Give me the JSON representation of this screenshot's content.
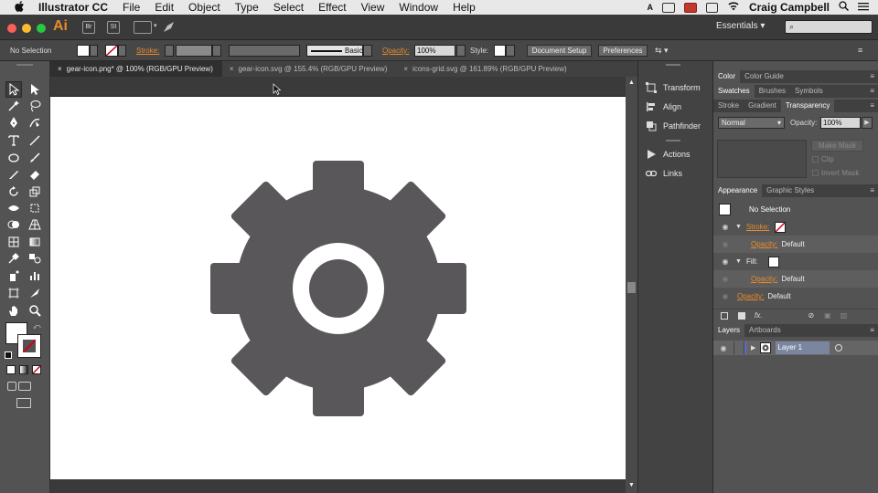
{
  "menubar": {
    "app_name": "Illustrator CC",
    "items": [
      "File",
      "Edit",
      "Object",
      "Type",
      "Select",
      "Effect",
      "View",
      "Window",
      "Help"
    ],
    "user": "Craig Campbell"
  },
  "appbar": {
    "logo": "Ai",
    "bridge_label": "Br",
    "stock_label": "St",
    "workspace": "Essentials",
    "search_placeholder": "⌕"
  },
  "control_bar": {
    "selection": "No Selection",
    "stroke_label": "Stroke:",
    "brush_label": "Basic",
    "opacity_label": "Opacity:",
    "opacity_value": "100%",
    "style_label": "Style:",
    "doc_setup": "Document Setup",
    "preferences": "Preferences"
  },
  "tabs": [
    {
      "label": "gear-icon.png* @ 100% (RGB/GPU Preview)",
      "active": true
    },
    {
      "label": "gear-icon.svg @ 155.4% (RGB/GPU Preview)",
      "active": false
    },
    {
      "label": "icons-grid.svg @ 161.89% (RGB/GPU Preview)",
      "active": false
    }
  ],
  "dock": {
    "items": [
      "Transform",
      "Align",
      "Pathfinder",
      "Actions",
      "Links"
    ]
  },
  "color_panel": {
    "tabs": [
      "Color",
      "Color Guide"
    ]
  },
  "swatch_panel": {
    "tabs": [
      "Swatches",
      "Brushes",
      "Symbols"
    ]
  },
  "transparency_panel": {
    "tabs": [
      "Stroke",
      "Gradient",
      "Transparency"
    ],
    "blend_mode": "Normal",
    "opacity_label": "Opacity:",
    "opacity_value": "100%",
    "make_mask": "Make Mask",
    "clip": "Clip",
    "invert_mask": "Invert Mask"
  },
  "appearance_panel": {
    "tabs": [
      "Appearance",
      "Graphic Styles"
    ],
    "title": "No Selection",
    "stroke_label": "Stroke:",
    "fill_label": "Fill:",
    "opacity_label": "Opacity:",
    "opacity_default": "Default"
  },
  "layers_panel": {
    "tabs": [
      "Layers",
      "Artboards"
    ],
    "layer_name": "Layer 1"
  },
  "colors": {
    "gear": "#59575a",
    "accent_orange": "#e88b2a",
    "layer_color": "#5b6bd6"
  }
}
